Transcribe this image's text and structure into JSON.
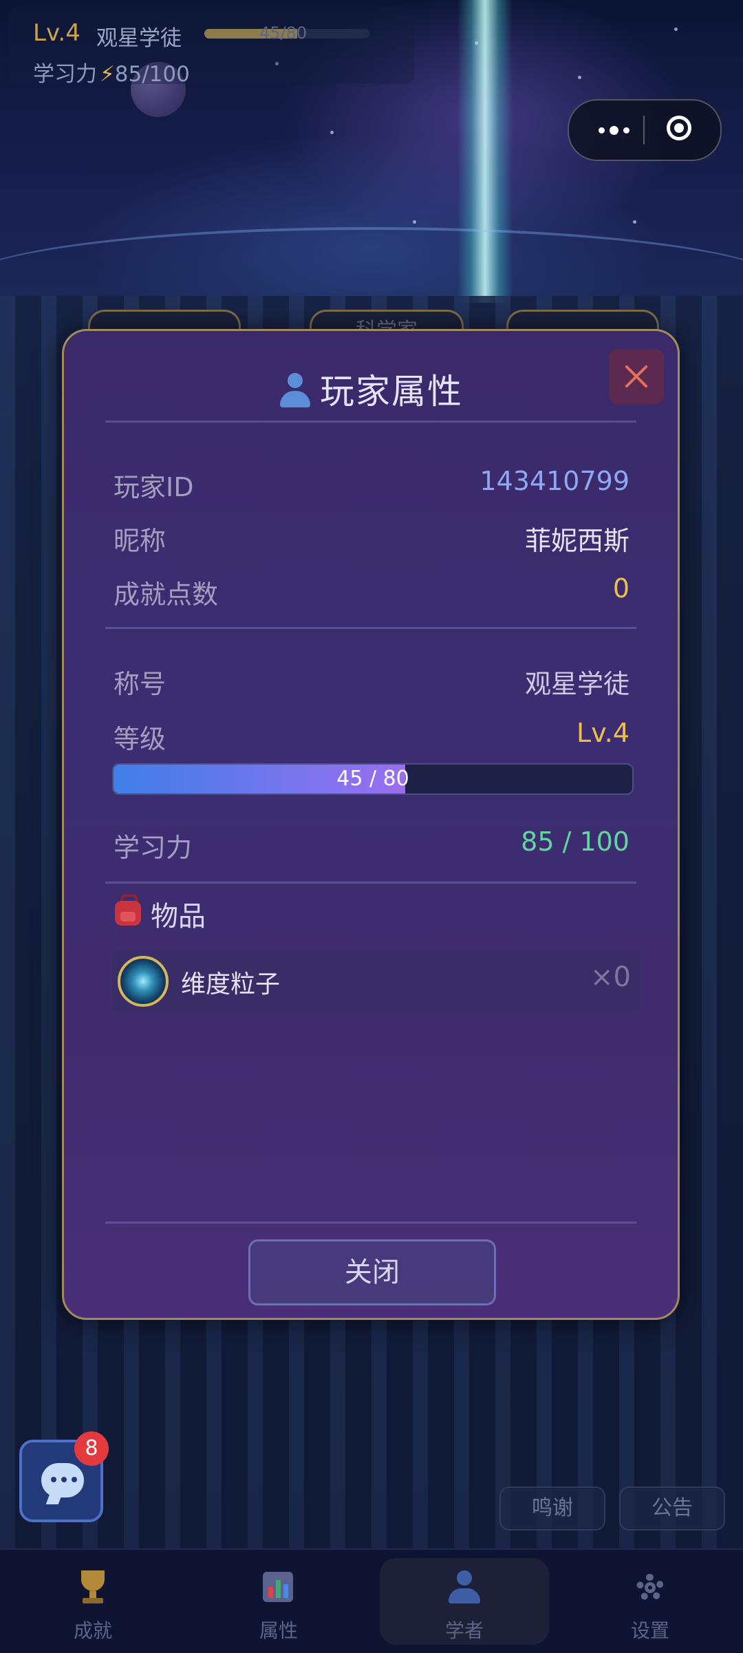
{
  "hud": {
    "level": "Lv.4",
    "title": "观星学徒",
    "xp_text": "45/80",
    "xp_progress": 0.5625,
    "power_label": "学习力",
    "power_value": "85/100"
  },
  "background_tabs": [
    "",
    "科学家",
    ""
  ],
  "modal": {
    "title": "玩家属性",
    "rows": {
      "player_id": {
        "label": "玩家ID",
        "value": "143410799"
      },
      "nickname": {
        "label": "昵称",
        "value": "菲妮西斯"
      },
      "achievement_points": {
        "label": "成就点数",
        "value": "0"
      },
      "title": {
        "label": "称号",
        "value": "观星学徒"
      },
      "level": {
        "label": "等级",
        "value": "Lv.4"
      },
      "power": {
        "label": "学习力",
        "value": "85 / 100"
      }
    },
    "xp": {
      "text": "45 / 80",
      "progress": 0.5625
    },
    "items_section_label": "物品",
    "items": [
      {
        "name": "维度粒子",
        "count": "×0"
      }
    ],
    "close_button": "关闭"
  },
  "chat": {
    "badge": "8"
  },
  "buttons": {
    "credits": "鸣谢",
    "notice": "公告"
  },
  "bottom_nav": [
    {
      "label": "成就",
      "icon": "trophy-icon"
    },
    {
      "label": "属性",
      "icon": "bar-chart-icon"
    },
    {
      "label": "学者",
      "icon": "user-icon",
      "active": true
    },
    {
      "label": "设置",
      "icon": "gear-icon"
    }
  ],
  "colors": {
    "modal_bg": "#3c2d72",
    "modal_border": "#a38a5e",
    "accent_gold": "#ecc04d",
    "accent_green": "#62d6a0",
    "accent_blue": "#8fa8f3",
    "close_red": "#e4715c"
  }
}
